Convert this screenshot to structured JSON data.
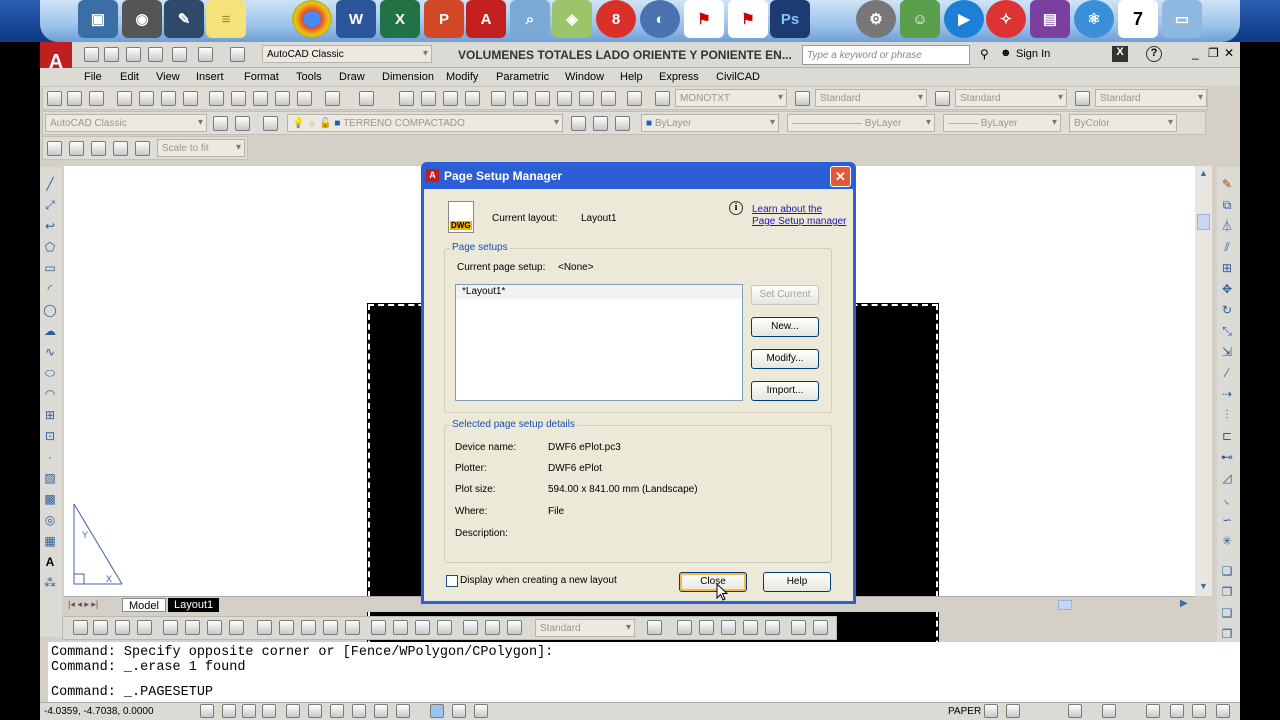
{
  "window": {
    "title": "VOLUMENES TOTALES LADO ORIENTE Y PONIENTE EN...",
    "workspace": "AutoCAD Classic",
    "search_placeholder": "Type a keyword or phrase",
    "sign_in": "Sign In"
  },
  "menu": [
    "File",
    "Edit",
    "View",
    "Insert",
    "Format",
    "Tools",
    "Draw",
    "Dimension",
    "Modify",
    "Parametric",
    "Window",
    "Help",
    "Express",
    "CivilCAD"
  ],
  "toolbars": {
    "text_style": "MONOTXT",
    "dim_style": "Standard",
    "table_style": "Standard",
    "mleader_style": "Standard",
    "workspace_combo": "AutoCAD Classic",
    "layer": "TERRENO COMPACTADO",
    "color": "ByLayer",
    "linetype": "ByLayer",
    "lineweight": "ByLayer",
    "plotstyle": "ByColor",
    "viewport_scale": "Scale to fit",
    "dim_combo": "Standard"
  },
  "tabs": [
    "Model",
    "Layout1"
  ],
  "command_lines": [
    "Command: Specify opposite corner or [Fence/WPolygon/CPolygon]:",
    "Command: _.erase 1 found",
    "Command: _.PAGESETUP"
  ],
  "status": {
    "coords": "-4.0359, -4.7038, 0.0000",
    "paper": "PAPER"
  },
  "dialog": {
    "title": "Page Setup Manager",
    "icon_label": "DWG",
    "current_layout_label": "Current layout:",
    "current_layout_value": "Layout1",
    "learn_link_1": "Learn about the",
    "learn_link_2": "Page Setup manager",
    "page_setups_title": "Page setups",
    "current_page_setup_label": "Current page setup:",
    "current_page_setup_value": "<None>",
    "list_items": [
      "*Layout1*"
    ],
    "btn_set_current": "Set Current",
    "btn_new": "New...",
    "btn_modify": "Modify...",
    "btn_import": "Import...",
    "details_title": "Selected page setup details",
    "details": [
      {
        "label": "Device name:",
        "value": "DWF6 ePlot.pc3"
      },
      {
        "label": "Plotter:",
        "value": "DWF6 ePlot"
      },
      {
        "label": "Plot size:",
        "value": "594.00 x 841.00 mm (Landscape)"
      },
      {
        "label": "Where:",
        "value": "File"
      },
      {
        "label": "Description:",
        "value": ""
      }
    ],
    "checkbox_label": "Display when creating a new layout",
    "btn_close": "Close",
    "btn_help": "Help"
  },
  "dock_icons": [
    "computer-icon",
    "camera-icon",
    "scanner-icon",
    "notes-icon",
    "chrome-icon",
    "word-icon",
    "excel-icon",
    "powerpoint-icon",
    "autocad-icon",
    "search-icon",
    "maps-icon",
    "office-icon",
    "settings-icon",
    "acrobat-icon",
    "acrobat-reader-icon",
    "photoshop-icon",
    "gear-icon",
    "users-icon",
    "media-player-icon",
    "ccleaner-icon",
    "winrar-icon",
    "network-icon",
    "calendar-icon",
    "folder-icon"
  ],
  "dock_calendar_day": "7"
}
